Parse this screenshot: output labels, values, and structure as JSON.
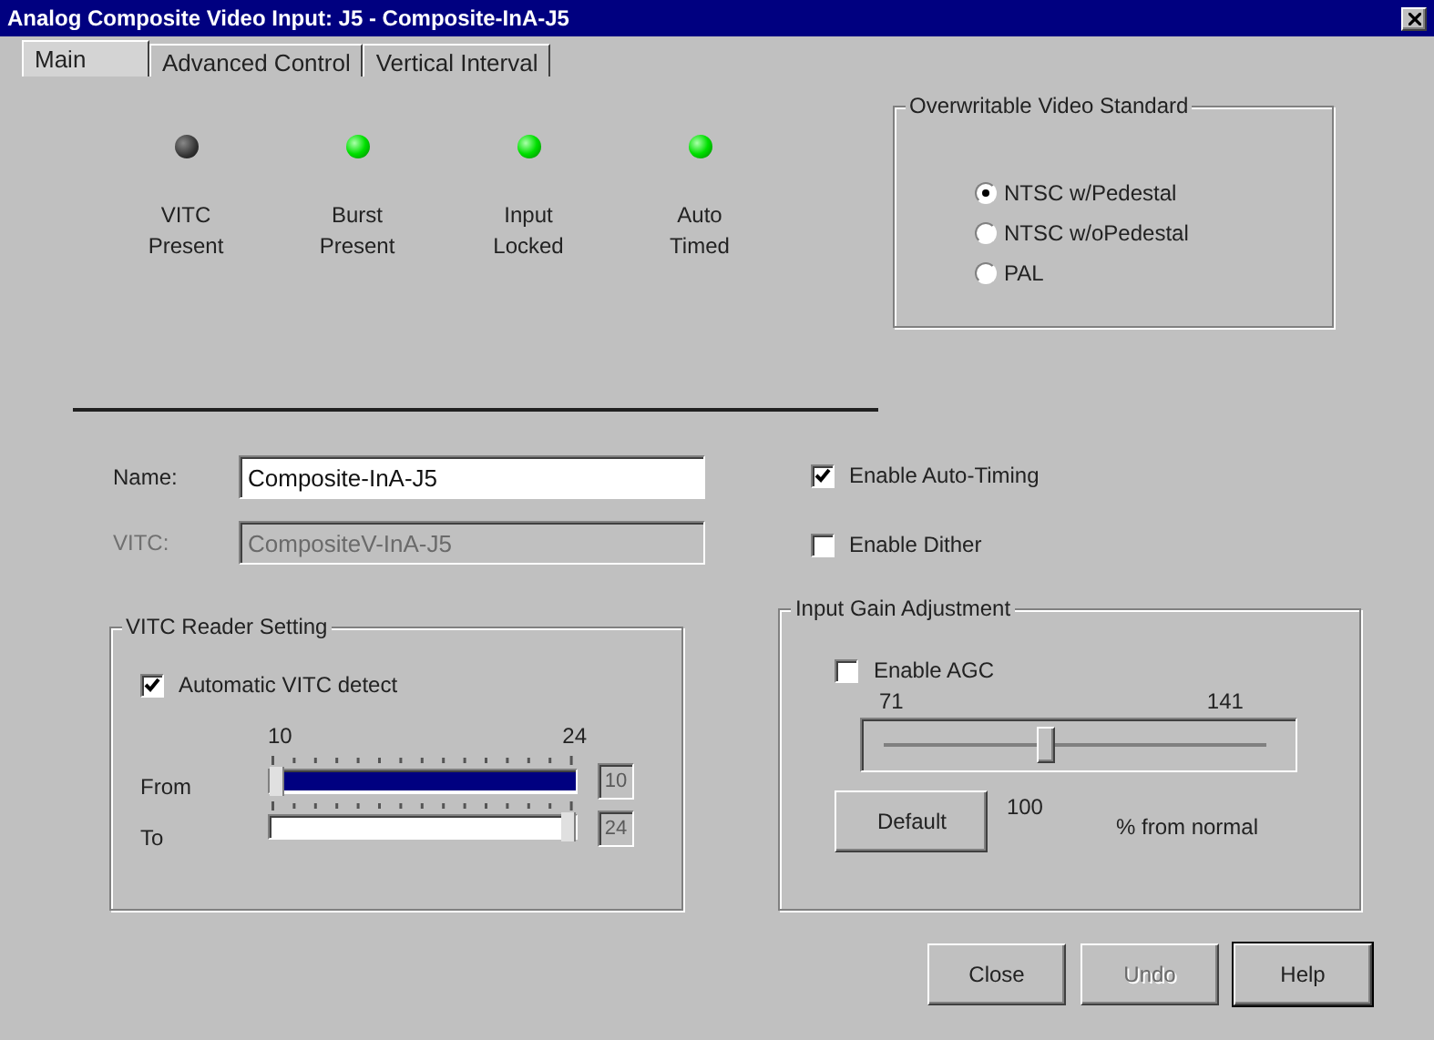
{
  "window": {
    "title": "Analog Composite Video Input: J5 - Composite-InA-J5"
  },
  "tabs": [
    {
      "label": "Main",
      "selected": true
    },
    {
      "label": "Advanced Control",
      "selected": false
    },
    {
      "label": "Vertical Interval",
      "selected": false
    }
  ],
  "indicators": [
    {
      "label": "VITC Present",
      "on": false
    },
    {
      "label": "Burst Present",
      "on": true
    },
    {
      "label": "Input Locked",
      "on": true
    },
    {
      "label": "Auto Timed",
      "on": true
    }
  ],
  "video_standard": {
    "title": "Overwritable Video Standard",
    "options": [
      {
        "label": "NTSC w/Pedestal",
        "selected": true
      },
      {
        "label": "NTSC w/oPedestal",
        "selected": false
      },
      {
        "label": "PAL",
        "selected": false
      }
    ]
  },
  "fields": [
    {
      "label": "Name:",
      "value": "Composite-InA-J5",
      "disabled": false
    },
    {
      "label": "VITC:",
      "value": "CompositeV-InA-J5",
      "disabled": true
    }
  ],
  "options": [
    {
      "label": "Enable Auto-Timing",
      "checked": true
    },
    {
      "label": "Enable Dither",
      "checked": false
    }
  ],
  "vitc_reader": {
    "title": "VITC Reader Setting",
    "auto_detect": {
      "label": "Automatic VITC detect",
      "checked": true
    },
    "min": "10",
    "max": "24",
    "from": {
      "label": "From",
      "level": 0,
      "value": "10"
    },
    "to": {
      "label": "To",
      "level": 1,
      "value": "24"
    }
  },
  "gain": {
    "title": "Input Gain Adjustment",
    "agc": {
      "label": "Enable AGC",
      "checked": false
    },
    "min": "71",
    "max": "141",
    "level": 0.42,
    "default_button": "Default",
    "value": "100",
    "unit": "% from normal"
  },
  "buttons": [
    {
      "label": "Close",
      "disabled": false,
      "default": false
    },
    {
      "label": "Undo",
      "disabled": true,
      "default": false
    },
    {
      "label": "Help",
      "disabled": false,
      "default": true
    }
  ]
}
